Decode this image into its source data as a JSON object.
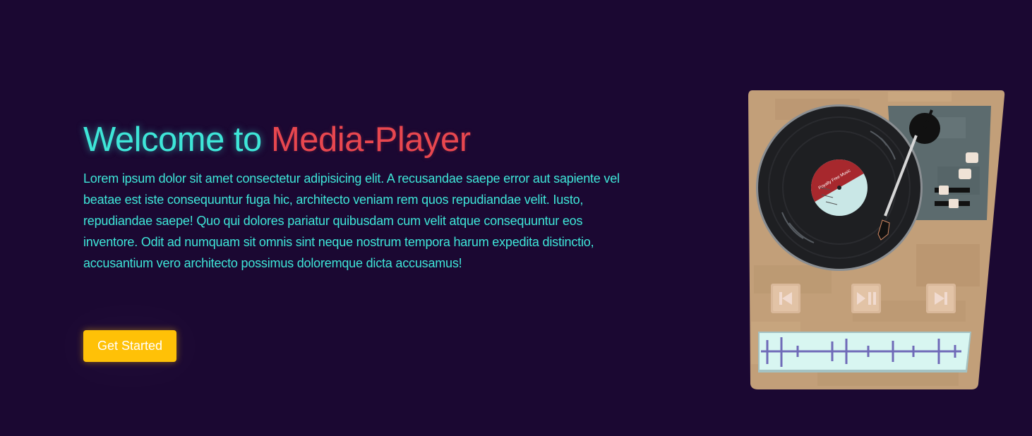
{
  "hero": {
    "title_part1": "Welcome to",
    "title_part2": "Media-Player",
    "description": "Lorem ipsum dolor sit amet consectetur adipisicing elit. A recusandae saepe error aut sapiente vel beatae est iste consequuntur fuga hic, architecto veniam rem quos repudiandae velit. Iusto, repudiandae saepe! Quo qui dolores pariatur quibusdam cum velit atque consequuntur eos inventore. Odit ad numquam sit omnis sint neque nostrum tempora harum expedita distinctio, accusantium vero architecto possimus doloremque dicta accusamus!",
    "cta_label": "Get Started"
  },
  "illustration": {
    "record_label_text": "Royalty Free Music",
    "icons": [
      "turntable-icon",
      "vinyl-record-icon",
      "tonearm-icon",
      "previous-track-icon",
      "play-pause-icon",
      "next-track-icon",
      "waveform-icon"
    ]
  },
  "colors": {
    "background": "#1b0832",
    "accent_cyan": "#3ee6d8",
    "accent_red": "#e8474f",
    "button_yellow": "#ffc107",
    "turntable_body": "#c29f79",
    "record": "#1e1f22",
    "panel": "#5c6b6e",
    "wave_bar": "#d8f6f1",
    "wave_line": "#6f6ab8"
  }
}
